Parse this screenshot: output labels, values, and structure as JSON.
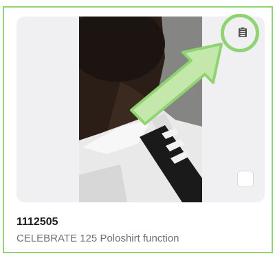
{
  "product": {
    "id": "1112505",
    "name": "CELEBRATE 125 Poloshirt function"
  },
  "icons": {
    "clipboard": "clipboard-icon",
    "annotation_arrow": "arrow-icon"
  },
  "colors": {
    "annotation": "#8fd372",
    "card_background": "#f0f0f2",
    "id_text": "#1c1c1e",
    "name_text": "#6e6e73"
  }
}
